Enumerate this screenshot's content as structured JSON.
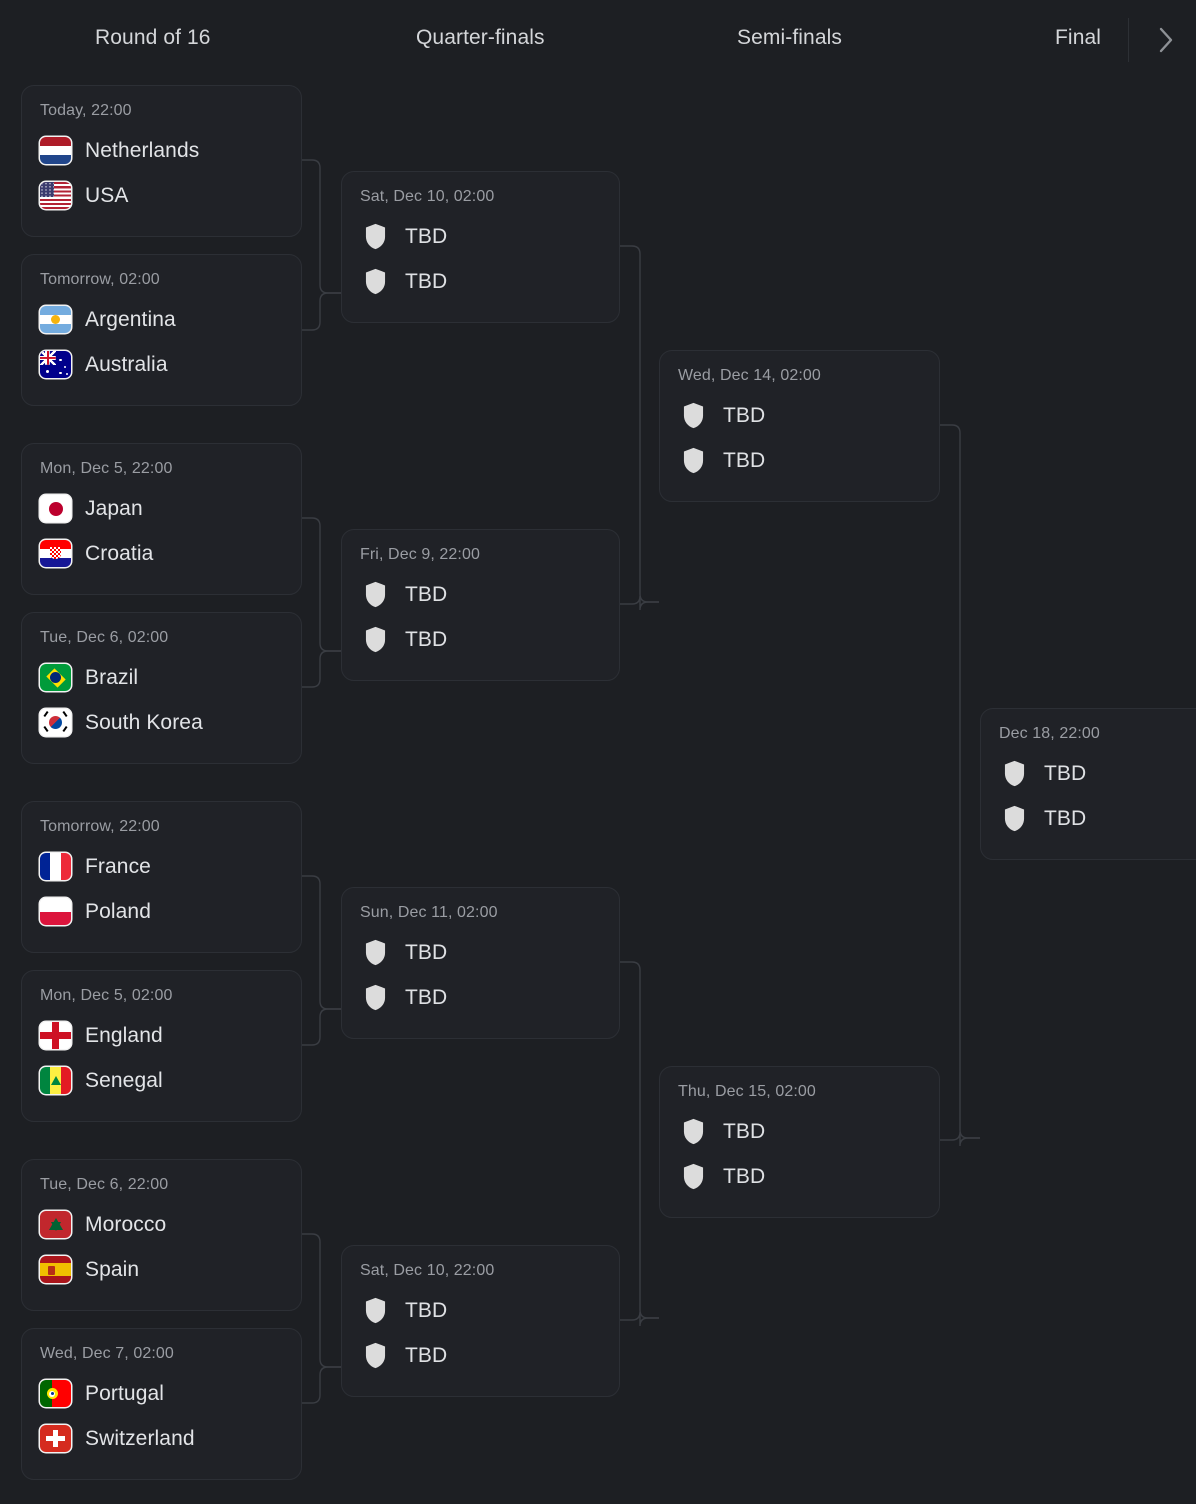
{
  "header": {
    "rounds": [
      {
        "label": "Round of 16"
      },
      {
        "label": "Quarter-finals"
      },
      {
        "label": "Semi-finals"
      },
      {
        "label": "Final"
      }
    ],
    "next_button_icon": "chevron-right-icon"
  },
  "placeholder": {
    "team_name": "TBD",
    "icon": "shield-icon"
  },
  "colors": {
    "page_background": "#1d1f23",
    "card_background": "#202227",
    "card_border": "#2c2f35",
    "connector_line": "#3a3d43",
    "primary_text": "#e2e4e7",
    "muted_text": "#9a9da3",
    "shield_fill": "#dcdcdc"
  },
  "rounds": [
    {
      "name": "Round of 16",
      "matches": [
        {
          "date": "Today, 22:00",
          "teams": [
            {
              "name": "Netherlands",
              "flag": "flag-netherlands"
            },
            {
              "name": "USA",
              "flag": "flag-usa"
            }
          ]
        },
        {
          "date": "Tomorrow, 02:00",
          "teams": [
            {
              "name": "Argentina",
              "flag": "flag-argentina"
            },
            {
              "name": "Australia",
              "flag": "flag-australia"
            }
          ]
        },
        {
          "date": "Mon, Dec 5, 22:00",
          "teams": [
            {
              "name": "Japan",
              "flag": "flag-japan"
            },
            {
              "name": "Croatia",
              "flag": "flag-croatia"
            }
          ]
        },
        {
          "date": "Tue, Dec 6, 02:00",
          "teams": [
            {
              "name": "Brazil",
              "flag": "flag-brazil"
            },
            {
              "name": "South Korea",
              "flag": "flag-south-korea"
            }
          ]
        },
        {
          "date": "Tomorrow, 22:00",
          "teams": [
            {
              "name": "France",
              "flag": "flag-france"
            },
            {
              "name": "Poland",
              "flag": "flag-poland"
            }
          ]
        },
        {
          "date": "Mon, Dec 5, 02:00",
          "teams": [
            {
              "name": "England",
              "flag": "flag-england"
            },
            {
              "name": "Senegal",
              "flag": "flag-senegal"
            }
          ]
        },
        {
          "date": "Tue, Dec 6, 22:00",
          "teams": [
            {
              "name": "Morocco",
              "flag": "flag-morocco"
            },
            {
              "name": "Spain",
              "flag": "flag-spain"
            }
          ]
        },
        {
          "date": "Wed, Dec 7, 02:00",
          "teams": [
            {
              "name": "Portugal",
              "flag": "flag-portugal"
            },
            {
              "name": "Switzerland",
              "flag": "flag-switzerland"
            }
          ]
        }
      ]
    },
    {
      "name": "Quarter-finals",
      "matches": [
        {
          "date": "Sat, Dec 10, 02:00",
          "teams": [
            {
              "name": "TBD",
              "flag": "shield"
            },
            {
              "name": "TBD",
              "flag": "shield"
            }
          ]
        },
        {
          "date": "Fri, Dec 9, 22:00",
          "teams": [
            {
              "name": "TBD",
              "flag": "shield"
            },
            {
              "name": "TBD",
              "flag": "shield"
            }
          ]
        },
        {
          "date": "Sun, Dec 11, 02:00",
          "teams": [
            {
              "name": "TBD",
              "flag": "shield"
            },
            {
              "name": "TBD",
              "flag": "shield"
            }
          ]
        },
        {
          "date": "Sat, Dec 10, 22:00",
          "teams": [
            {
              "name": "TBD",
              "flag": "shield"
            },
            {
              "name": "TBD",
              "flag": "shield"
            }
          ]
        }
      ]
    },
    {
      "name": "Semi-finals",
      "matches": [
        {
          "date": "Wed, Dec 14, 02:00",
          "teams": [
            {
              "name": "TBD",
              "flag": "shield"
            },
            {
              "name": "TBD",
              "flag": "shield"
            }
          ]
        },
        {
          "date": "Thu, Dec 15, 02:00",
          "teams": [
            {
              "name": "TBD",
              "flag": "shield"
            },
            {
              "name": "TBD",
              "flag": "shield"
            }
          ]
        }
      ]
    },
    {
      "name": "Final",
      "matches": [
        {
          "date": "Dec 18, 22:00",
          "teams": [
            {
              "name": "TBD",
              "flag": "shield"
            },
            {
              "name": "TBD",
              "flag": "shield"
            }
          ]
        }
      ]
    }
  ]
}
